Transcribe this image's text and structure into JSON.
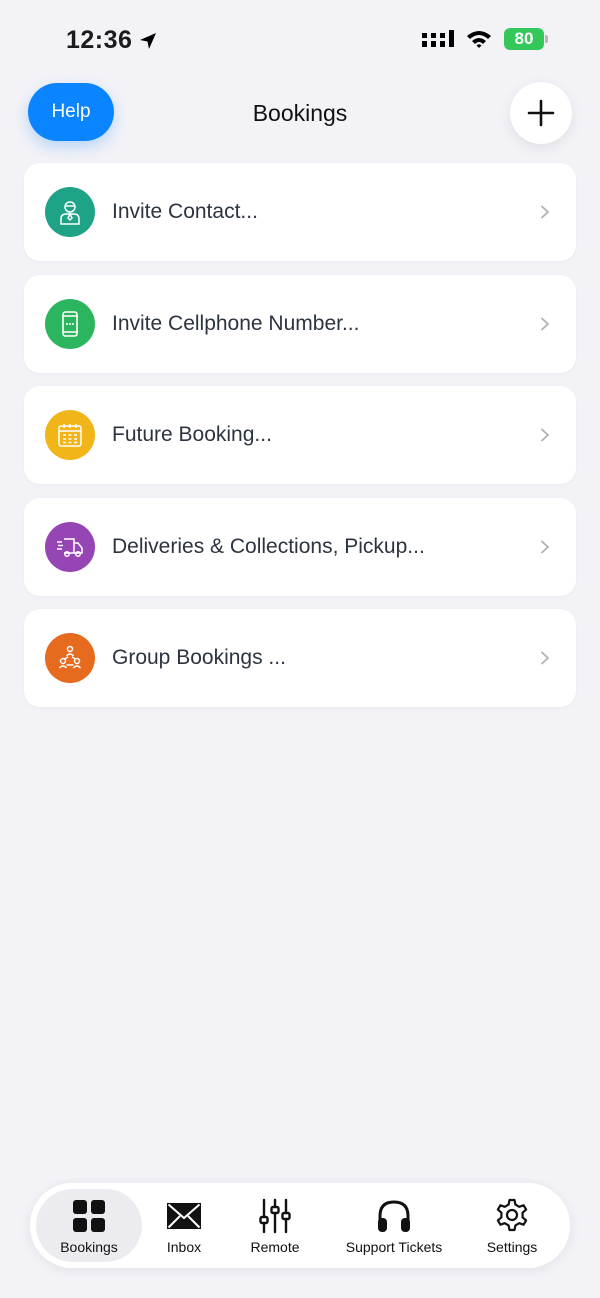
{
  "status_bar": {
    "time": "12:36",
    "battery": "80"
  },
  "header": {
    "help_label": "Help",
    "title": "Bookings",
    "add_icon": "plus-icon"
  },
  "menu": {
    "items": [
      {
        "label": "Invite Contact...",
        "icon": "person-icon",
        "color": "#1fa387"
      },
      {
        "label": "Invite Cellphone Number...",
        "icon": "phone-icon",
        "color": "#2bb55f"
      },
      {
        "label": "Future Booking...",
        "icon": "calendar-icon",
        "color": "#f2b519"
      },
      {
        "label": "Deliveries & Collections, Pickup...",
        "icon": "truck-icon",
        "color": "#9646b4"
      },
      {
        "label": "Group Bookings ...",
        "icon": "group-icon",
        "color": "#e66b1f"
      }
    ]
  },
  "tab_bar": {
    "tabs": [
      {
        "label": "Bookings",
        "icon": "grid-icon",
        "active": true
      },
      {
        "label": "Inbox",
        "icon": "envelope-icon"
      },
      {
        "label": "Remote",
        "icon": "sliders-icon"
      },
      {
        "label": "Support Tickets",
        "icon": "headphones-icon"
      },
      {
        "label": "Settings",
        "icon": "gear-icon"
      }
    ]
  },
  "colors": {
    "accent": "#0a84ff",
    "background": "#f2f2f7",
    "battery": "#34c759"
  }
}
